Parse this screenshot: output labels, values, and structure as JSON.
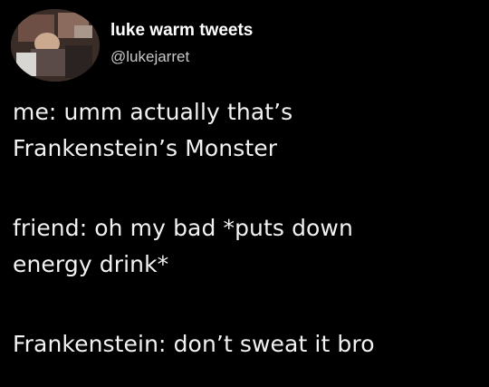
{
  "author": {
    "display_name": "luke warm tweets",
    "handle": "@lukejarret",
    "avatar_icon": "profile-photo-icon"
  },
  "tweet": {
    "lines": [
      "me: umm actually that’s",
      "Frankenstein’s Monster",
      "friend: oh my bad *puts down",
      "energy drink*",
      "Frankenstein: don’t sweat it bro"
    ]
  },
  "colors": {
    "background": "#000000",
    "text": "#ffffff",
    "handle": "#c9c9c9"
  }
}
